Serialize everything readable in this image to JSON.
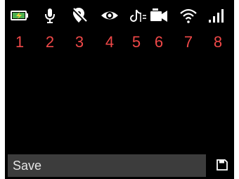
{
  "status_icons": [
    {
      "name": "battery-charging-icon",
      "number": "1"
    },
    {
      "name": "microphone-icon",
      "number": "2"
    },
    {
      "name": "location-off-icon",
      "number": "3"
    },
    {
      "name": "eye-icon",
      "number": "4"
    },
    {
      "name": "tiktok-icon",
      "number": "5"
    },
    {
      "name": "video-camera-icon",
      "number": "6"
    },
    {
      "name": "wifi-icon",
      "number": "7"
    },
    {
      "name": "signal-bars-icon",
      "number": "8"
    }
  ],
  "bottom_bar": {
    "label": "Save",
    "save_icon": "save-icon"
  },
  "colors": {
    "background": "#000000",
    "number_color": "#ef4848",
    "icon_color": "#ffffff",
    "battery_fill": "#4caf50",
    "bolt": "#f4d03f",
    "bar_bg": "#3c3c3c"
  }
}
